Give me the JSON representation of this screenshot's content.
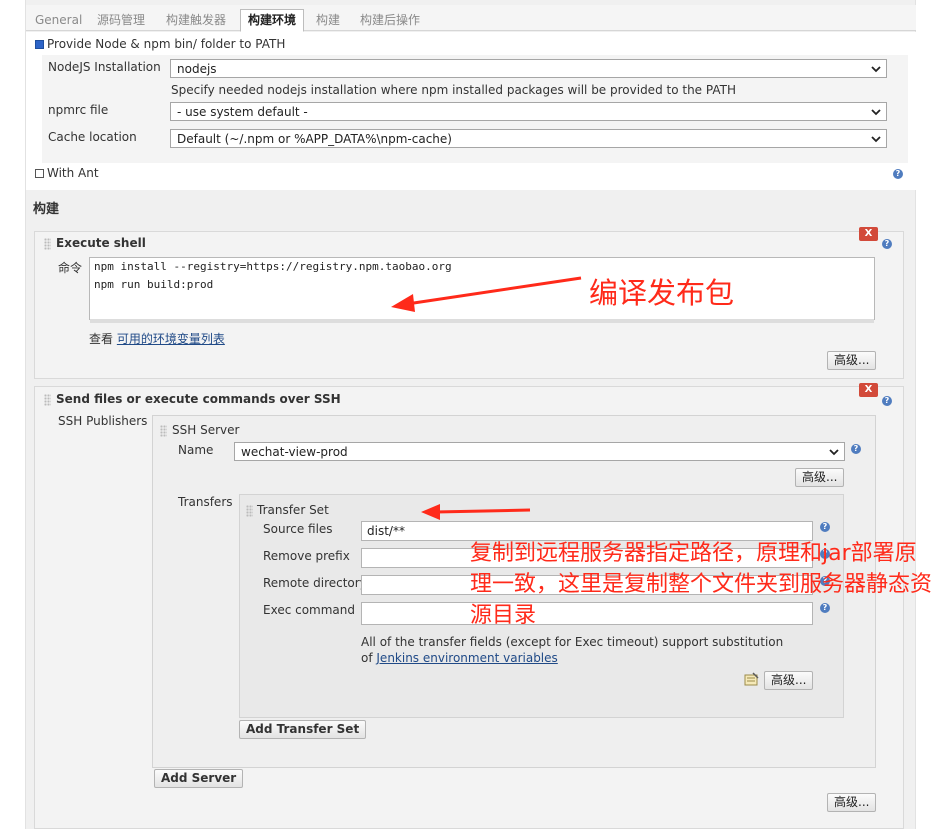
{
  "tabs": [
    {
      "label": "General"
    },
    {
      "label": "源码管理"
    },
    {
      "label": "构建触发器"
    },
    {
      "label": "构建环境"
    },
    {
      "label": "构建"
    },
    {
      "label": "构建后操作"
    }
  ],
  "build_env": {
    "provide_node_label": "Provide Node & npm bin/ folder to PATH",
    "provide_node_checked": true,
    "nodejs_installation_label": "NodeJS Installation",
    "nodejs_installation_value": "nodejs",
    "nodejs_hint": "Specify needed nodejs installation where npm installed packages will be provided to the PATH",
    "npmrc_label": "npmrc file",
    "npmrc_value": "- use system default -",
    "cache_label": "Cache location",
    "cache_value": "Default (~/.npm or %APP_DATA%\\npm-cache)",
    "with_ant_label": "With Ant",
    "with_ant_checked": false
  },
  "build": {
    "section_title": "构建",
    "execute_shell": {
      "title": "Execute shell",
      "command_label": "命令",
      "command_lines": [
        "npm install --registry=https://registry.npm.taobao.org",
        "npm run build:prod"
      ],
      "view_prefix": "查看",
      "env_link": "可用的环境变量列表",
      "advanced_label": "高级...",
      "delete_label": "X"
    },
    "ssh": {
      "title": "Send files or execute commands over SSH",
      "publishers_label": "SSH Publishers",
      "server_title": "SSH Server",
      "name_label": "Name",
      "name_value": "wechat-view-prod",
      "server_advanced_label": "高级...",
      "transfers_label": "Transfers",
      "transfer_set_title": "Transfer Set",
      "source_files_label": "Source files",
      "source_files_value": "dist/**",
      "remove_prefix_label": "Remove prefix",
      "remove_prefix_value": "",
      "remote_dir_label": "Remote directory",
      "remote_dir_value": "",
      "exec_command_label": "Exec command",
      "exec_command_value": "",
      "transfer_note": "All of the transfer fields (except for Exec timeout) support substitution of ",
      "transfer_note_link": "Jenkins environment variables",
      "transfer_advanced_label": "高级...",
      "add_transfer_set_label": "Add Transfer Set",
      "add_server_label": "Add Server",
      "bottom_advanced_label": "高级...",
      "delete_label": "X"
    }
  },
  "annotations": {
    "compile_publish": "编译发布包",
    "copy_note": "复制到远程服务器指定路径，原理和jar部署原理一致，这里是复制整个文件夹到服务器静态资源目录"
  },
  "colors": {
    "annotation_red": "#ff2a1a",
    "delete_red": "#d24a3a",
    "help_blue": "#4f7cbf",
    "link_blue": "#204a87"
  }
}
